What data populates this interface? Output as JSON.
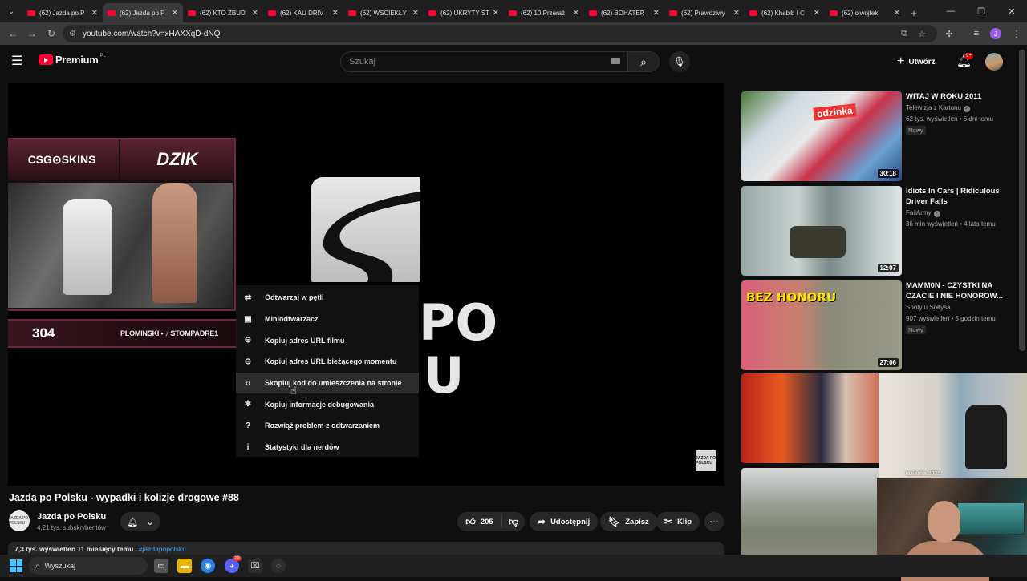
{
  "browser": {
    "tabs": [
      {
        "title": "(62) Jazda po P",
        "active": false
      },
      {
        "title": "(62) Jazda po P",
        "active": true
      },
      {
        "title": "(62) KTO ZBUD",
        "active": false
      },
      {
        "title": "(62) KAU DRIV",
        "active": false
      },
      {
        "title": "(62) WŚCIEKŁY",
        "active": false
      },
      {
        "title": "(62) UKRYTY ST",
        "active": false
      },
      {
        "title": "(62) 10 Przeraż",
        "active": false
      },
      {
        "title": "(62) BOHATER",
        "active": false
      },
      {
        "title": "(62) Prawdziwy",
        "active": false
      },
      {
        "title": "(62) Khabib I C",
        "active": false
      },
      {
        "title": "(62) ojwojtek",
        "active": false
      }
    ],
    "url": "youtube.com/watch?v=xHAXXqD-dNQ",
    "profile_letter": "J",
    "accent": "#ff0033"
  },
  "header": {
    "brand": "Premium",
    "country": "PL",
    "search_placeholder": "Szukaj",
    "create_label": "Utwórz",
    "notification_count": "9+"
  },
  "player": {
    "sponsor_left": "CSG⊙SKINS",
    "sponsor_right": "DZIK",
    "counter_value": "304",
    "counter_text": "PLOMINSKI • ♪ STOMPADRE1",
    "overlay_letters_1": "PO",
    "overlay_letters_2": "U",
    "corner_logo_text": "JAZDA PO POLSKU",
    "context_menu": [
      {
        "icon": "⇄",
        "label": "Odtwarzaj w pętli"
      },
      {
        "icon": "▣",
        "label": "Miniodtwarzacz"
      },
      {
        "icon": "⊖",
        "label": "Kopiuj adres URL filmu"
      },
      {
        "icon": "⊖",
        "label": "Kopiuj adres URL bieżącego momentu"
      },
      {
        "icon": "‹›",
        "label": "Skopiuj kod do umieszczenia na stronie"
      },
      {
        "icon": "✻",
        "label": "Kopiuj informacje debugowania"
      },
      {
        "icon": "?",
        "label": "Rozwiąż problem z odtwarzaniem"
      },
      {
        "icon": "i",
        "label": "Statystyki dla nerdów"
      }
    ]
  },
  "video": {
    "title": "Jazda po Polsku - wypadki i kolizje drogowe #88",
    "channel_name": "Jazda po Polsku",
    "subscribers": "4,21 tys. subskrybentów",
    "channel_avatar_text": "JAZDA PO POLSKU",
    "likes": "205",
    "share_label": "Udostępnij",
    "save_label": "Zapisz",
    "clip_label": "Klip",
    "description_stats": "7,3 tys. wyświetleń  11 miesięcy temu",
    "description_tag": "#jazdapopolsku"
  },
  "recommendations": [
    {
      "title": "WITAJ W ROKU 2011",
      "channel": "Telewizja z Kartonu",
      "verified": true,
      "meta": "62 tys. wyświetleń • 6 dni temu",
      "badge": "Nowy",
      "duration": "30:18",
      "thumb_text": "odzinka"
    },
    {
      "title": "Idiots In Cars | Ridiculous Driver Fails",
      "channel": "FailArmy",
      "verified": true,
      "meta": "36 mln wyświetleń • 4 lata temu",
      "badge": "",
      "duration": "12:07",
      "thumb_text": ""
    },
    {
      "title": "MAMM0N - CZYSTKI NA CZACIE I NIE HONOROW...",
      "channel": "Shoty u Sołtysa",
      "verified": false,
      "meta": "907 wyświetleń • 5 godzin temu",
      "badge": "Nowy",
      "duration": "27:06",
      "thumb_text": "BEZ HONORU"
    },
    {
      "title": "",
      "channel": "",
      "verified": false,
      "meta": "",
      "badge": "",
      "duration": "",
      "thumb_text": ""
    },
    {
      "title": "",
      "channel": "",
      "verified": false,
      "meta": "",
      "badge": "",
      "duration": "",
      "thumb_text": ""
    }
  ],
  "webcam": {
    "room_caption": "łazienka 2025"
  },
  "taskbar": {
    "search_label": "Wyszukaj",
    "discord_badge": "29"
  }
}
